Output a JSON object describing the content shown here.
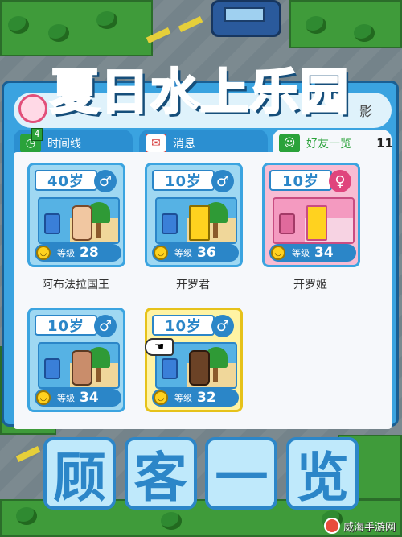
{
  "game_title": "夏日水上乐园",
  "bottom_title_chars": [
    "顾",
    "客",
    "一",
    "览"
  ],
  "header": {
    "right_text": "影"
  },
  "tabs": [
    {
      "label": "时间线",
      "badge": "4",
      "icon": "clock-icon"
    },
    {
      "label": "消息",
      "icon": "envelope-icon"
    },
    {
      "label": "好友一览",
      "icon": "friends-icon",
      "count": "11"
    }
  ],
  "guests": [
    {
      "age": "40岁",
      "gender": "♂",
      "level_label": "等级",
      "level": "28",
      "name": "阿布法拉国王",
      "icon": "king-figure"
    },
    {
      "age": "10岁",
      "gender": "♂",
      "level_label": "等级",
      "level": "36",
      "name": "开罗君",
      "icon": "kairobot-figure"
    },
    {
      "age": "10岁",
      "gender": "♀",
      "level_label": "等级",
      "level": "34",
      "name": "开罗姬",
      "icon": "kairo-princess-figure"
    },
    {
      "age": "10岁",
      "gender": "♂",
      "level_label": "等级",
      "level": "34",
      "name": "",
      "icon": "cat-figure"
    },
    {
      "age": "10岁",
      "gender": "♂",
      "level_label": "等级",
      "level": "32",
      "name": "",
      "icon": "monkey-figure"
    }
  ],
  "watermark": {
    "text": "威海手游网"
  },
  "colors": {
    "accent": "#2c86c8",
    "panel": "#3aa3e0",
    "selected": "#fff3a3",
    "female": "#e0457d"
  }
}
